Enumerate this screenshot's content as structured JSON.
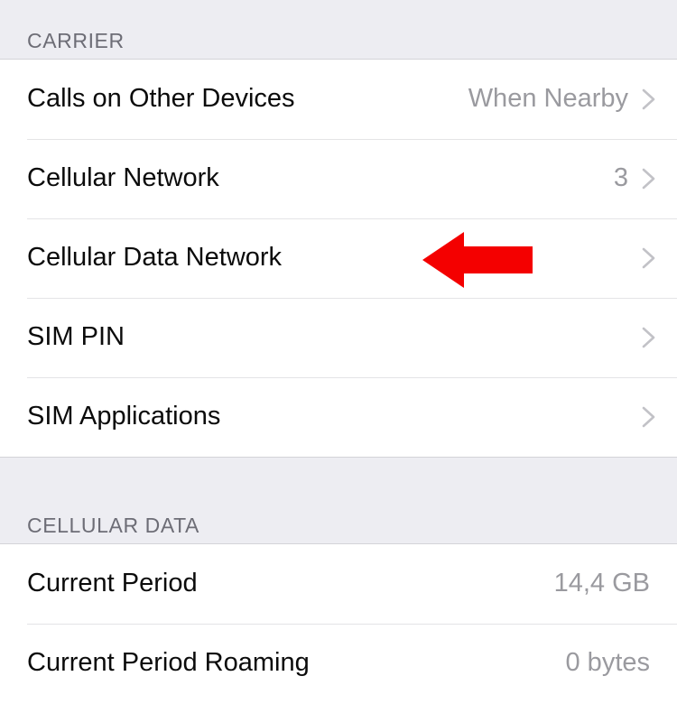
{
  "screen": {
    "name": "Cellular settings",
    "background": "#ffffff"
  },
  "colors": {
    "section_header_background": "#ededf2",
    "section_header_text": "#6d6d76",
    "row_background": "#ffffff",
    "row_label_text": "#0b0b0b",
    "row_value_text": "#9a9a9f",
    "separator": "#e4e4e6",
    "chevron": "#c2c2c7",
    "annotation_red": "#f40000"
  },
  "sections": [
    {
      "header": "CARRIER",
      "rows": [
        {
          "label": "Calls on Other Devices",
          "value": "When Nearby",
          "chevron": true
        },
        {
          "label": "Cellular Network",
          "value": "3",
          "chevron": true
        },
        {
          "label": "Cellular Data Network",
          "value": "",
          "chevron": true
        },
        {
          "label": "SIM PIN",
          "value": "",
          "chevron": true
        },
        {
          "label": "SIM Applications",
          "value": "",
          "chevron": true
        }
      ]
    },
    {
      "header": "CELLULAR DATA",
      "rows": [
        {
          "label": "Current Period",
          "value": "14,4 GB",
          "chevron": false
        },
        {
          "label": "Current Period Roaming",
          "value": "0 bytes",
          "chevron": false
        }
      ]
    }
  ],
  "annotation": {
    "type": "arrow",
    "direction": "left",
    "color": "#f40000",
    "points_at": "Cellular Data Network"
  }
}
